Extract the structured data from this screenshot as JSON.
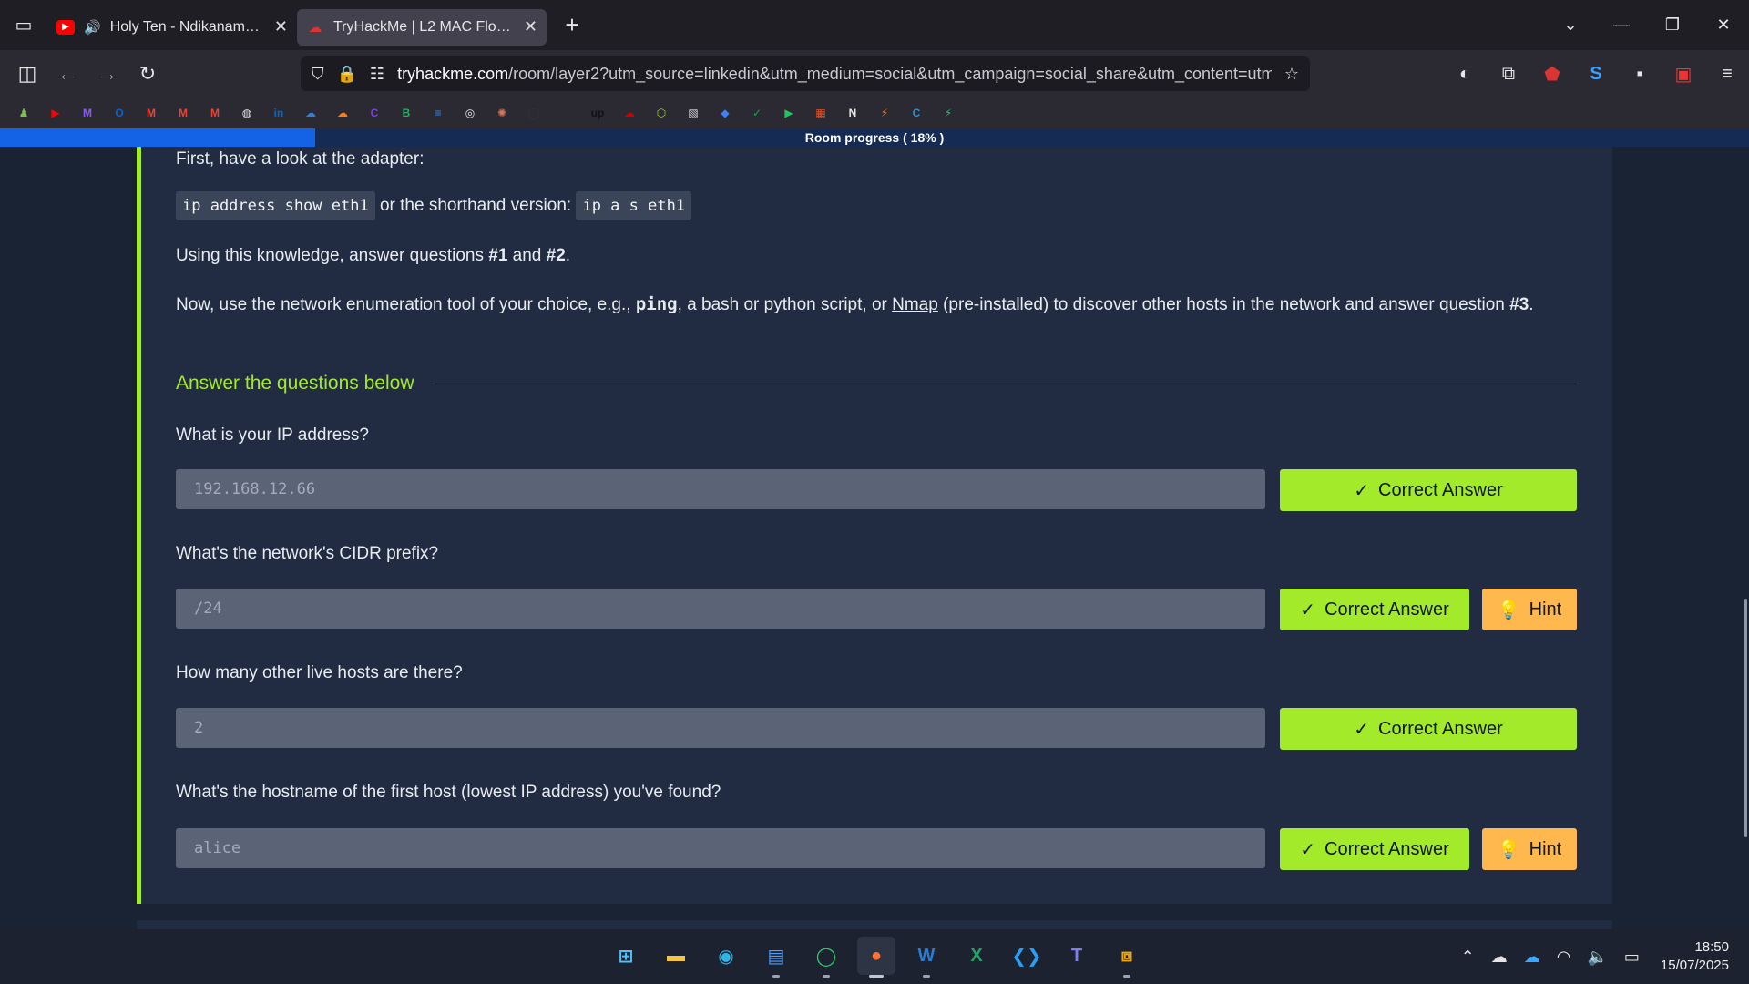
{
  "tabs": [
    {
      "title": "Holy Ten - Ndikanamata (ft.",
      "favicon": "youtube-icon",
      "audio": "speaker-icon",
      "active": false
    },
    {
      "title": "TryHackMe | L2 MAC Flooding &",
      "favicon": "tryhackme-icon",
      "active": true
    }
  ],
  "navbar": {
    "url_domain": "tryhackme.com",
    "url_path": "/room/layer2?utm_source=linkedin&utm_medium=social&utm_campaign=social_share&utm_content=utmCo"
  },
  "bookmarks": [
    "rook-icon",
    "youtube-icon",
    "proton-mail-icon",
    "outlook-icon",
    "gmail-icon",
    "gmail-icon",
    "gmail-icon",
    "globe-icon",
    "linkedin-icon",
    "cloud-icon",
    "cloudflare-icon",
    "c-icon",
    "b-icon",
    "bars-icon",
    "openai-icon",
    "claude-icon",
    "github-icon",
    "apple-icon",
    "upwork-icon",
    "redhat-icon",
    "box-icon",
    "image-icon",
    "diamond-icon",
    "check-icon",
    "play-icon",
    "microsoft-icon",
    "notion-icon",
    "bolt-icon",
    "c-circle-icon",
    "zap-icon"
  ],
  "progress": {
    "label": "Room progress ( 18% )",
    "percent": 18
  },
  "content": {
    "p1": "First, have a look at the adapter:",
    "code1": "ip address show eth1",
    "p2_mid": " or the shorthand version: ",
    "code2": "ip a s eth1",
    "p3_a": "Using this knowledge, answer questions ",
    "p3_b": "#1",
    "p3_c": " and ",
    "p3_d": "#2",
    "p3_e": ".",
    "p4_a": "Now, use the network enumeration tool of your choice, e.g., ",
    "p4_ping": "ping",
    "p4_b": ", a bash or python script, or ",
    "p4_nmap": "Nmap",
    "p4_c": " (pre-installed) to discover other hosts in the network and answer question ",
    "p4_d": "#3",
    "p4_e": "."
  },
  "section_title": "Answer the questions below",
  "questions": [
    {
      "text": "What is your IP address?",
      "answer": "192.168.12.66",
      "correct_label": "Correct Answer"
    },
    {
      "text": "What's the network's CIDR prefix?",
      "answer": "/24",
      "correct_label": "Correct Answer",
      "hint_label": "Hint"
    },
    {
      "text": "How many other live hosts are there?",
      "answer": "2",
      "correct_label": "Correct Answer"
    },
    {
      "text": "What's the hostname of the first host (lowest IP address) you've found?",
      "answer": "alice",
      "correct_label": "Correct Answer",
      "hint_label": "Hint"
    }
  ],
  "colors": {
    "accent": "#a3ea2a",
    "hint": "#ffb84d",
    "progress": "#1463e6"
  },
  "clock": {
    "time": "18:50",
    "date": "15/07/2025"
  }
}
